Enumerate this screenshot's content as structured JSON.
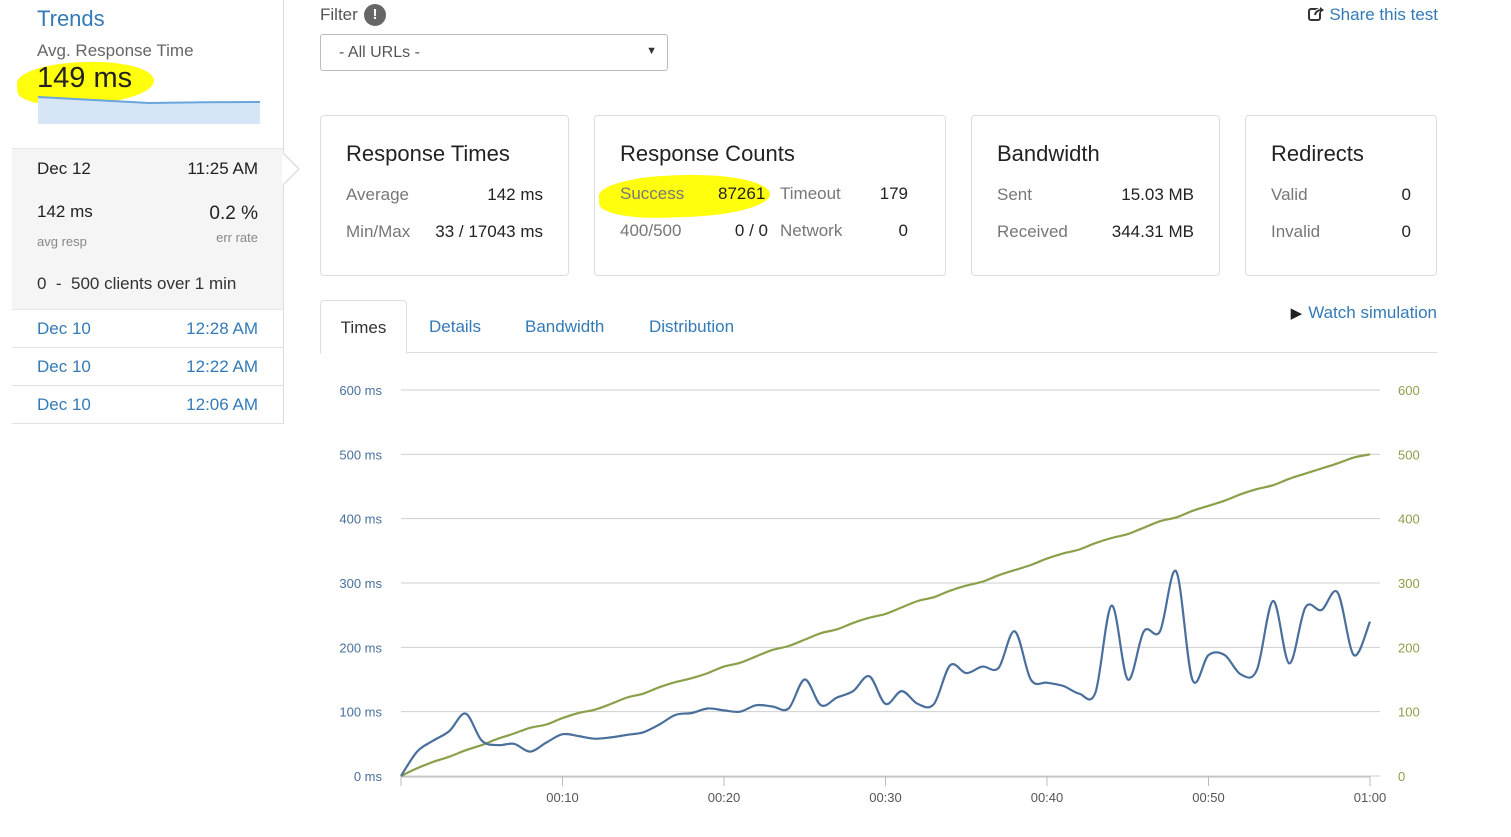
{
  "sidebar": {
    "title": "Trends",
    "avg_label": "Avg. Response Time",
    "avg_value": "149 ms",
    "current_run": {
      "date": "Dec 12",
      "time": "11:25 AM",
      "avg_resp": "142 ms",
      "avg_resp_label": "avg resp",
      "err_rate": "0.2 %",
      "err_rate_label": "err rate",
      "clients": "0  -  500 clients over 1 min"
    },
    "previous_runs": [
      {
        "date": "Dec 10",
        "time": "12:28 AM"
      },
      {
        "date": "Dec 10",
        "time": "12:22 AM"
      },
      {
        "date": "Dec 10",
        "time": "12:06 AM"
      }
    ]
  },
  "filter": {
    "label": "Filter",
    "info_icon": "!",
    "selected": "- All URLs -"
  },
  "share": {
    "label": "Share this test",
    "icon": "share-icon"
  },
  "cards": {
    "response_times": {
      "title": "Response Times",
      "average_label": "Average",
      "average_value": "142 ms",
      "minmax_label": "Min/Max",
      "minmax_value": "33 / 17043 ms"
    },
    "response_counts": {
      "title": "Response Counts",
      "success_label": "Success",
      "success_value": "87261",
      "timeout_label": "Timeout",
      "timeout_value": "179",
      "e400_label": "400/500",
      "e400_value": "0 / 0",
      "network_label": "Network",
      "network_value": "0"
    },
    "bandwidth": {
      "title": "Bandwidth",
      "sent_label": "Sent",
      "sent_value": "15.03 MB",
      "received_label": "Received",
      "received_value": "344.31 MB"
    },
    "redirects": {
      "title": "Redirects",
      "valid_label": "Valid",
      "valid_value": "0",
      "invalid_label": "Invalid",
      "invalid_value": "0"
    }
  },
  "tabs": [
    {
      "label": "Times",
      "active": true
    },
    {
      "label": "Details",
      "active": false
    },
    {
      "label": "Bandwidth",
      "active": false
    },
    {
      "label": "Distribution",
      "active": false
    }
  ],
  "watch_simulation": "Watch simulation",
  "colors": {
    "link": "#337ab7",
    "highlight": "#ffff00",
    "response_line": "#4a6f9c",
    "clients_line": "#8aa04a",
    "grid": "#cfcfcf"
  },
  "chart_data": {
    "type": "line",
    "left_axis_ticks": [
      "0 ms",
      "100 ms",
      "200 ms",
      "300 ms",
      "400 ms",
      "500 ms",
      "600 ms"
    ],
    "right_axis_ticks": [
      "0",
      "100",
      "200",
      "300",
      "400",
      "500",
      "600"
    ],
    "x_ticks": [
      "00:10",
      "00:20",
      "00:30",
      "00:40",
      "00:50",
      "01:00"
    ],
    "xlim": [
      0,
      60
    ],
    "ylim_left": [
      0,
      600
    ],
    "ylim_right": [
      0,
      600
    ],
    "series": [
      {
        "axis": "left",
        "color": "#4a6f9c",
        "x": [
          0,
          1,
          2,
          3,
          4,
          5,
          6,
          7,
          8,
          9,
          10,
          11,
          12,
          13,
          14,
          15,
          16,
          17,
          18,
          19,
          20,
          21,
          22,
          23,
          24,
          25,
          26,
          27,
          28,
          29,
          30,
          31,
          32,
          33,
          34,
          35,
          36,
          37,
          38,
          39,
          40,
          41,
          42,
          43,
          44,
          45,
          46,
          47,
          48,
          49,
          50,
          51,
          52,
          53,
          54,
          55,
          56,
          57,
          58,
          59,
          60
        ],
        "values": [
          0,
          38,
          55,
          70,
          97,
          55,
          48,
          50,
          38,
          52,
          65,
          62,
          58,
          60,
          64,
          68,
          80,
          95,
          98,
          105,
          102,
          100,
          110,
          108,
          105,
          150,
          110,
          122,
          132,
          155,
          112,
          132,
          112,
          112,
          172,
          160,
          170,
          168,
          225,
          150,
          145,
          140,
          128,
          130,
          265,
          150,
          225,
          225,
          318,
          150,
          188,
          188,
          158,
          165,
          272,
          175,
          262,
          258,
          285,
          188,
          240
        ]
      },
      {
        "axis": "right",
        "color": "#8aa04a",
        "x": [
          0,
          1,
          2,
          3,
          4,
          5,
          6,
          7,
          8,
          9,
          10,
          11,
          12,
          13,
          14,
          15,
          16,
          17,
          18,
          19,
          20,
          21,
          22,
          23,
          24,
          25,
          26,
          27,
          28,
          29,
          30,
          31,
          32,
          33,
          34,
          35,
          36,
          37,
          38,
          39,
          40,
          41,
          42,
          43,
          44,
          45,
          46,
          47,
          48,
          49,
          50,
          51,
          52,
          53,
          54,
          55,
          56,
          57,
          58,
          59,
          60
        ],
        "values": [
          0,
          12,
          22,
          30,
          40,
          48,
          58,
          66,
          75,
          80,
          90,
          98,
          103,
          112,
          122,
          128,
          138,
          146,
          152,
          160,
          170,
          176,
          186,
          196,
          202,
          212,
          222,
          228,
          238,
          246,
          252,
          262,
          272,
          278,
          288,
          296,
          302,
          312,
          320,
          328,
          338,
          346,
          352,
          362,
          370,
          376,
          386,
          396,
          402,
          412,
          420,
          428,
          438,
          446,
          452,
          462,
          470,
          478,
          486,
          495,
          500
        ]
      }
    ]
  }
}
